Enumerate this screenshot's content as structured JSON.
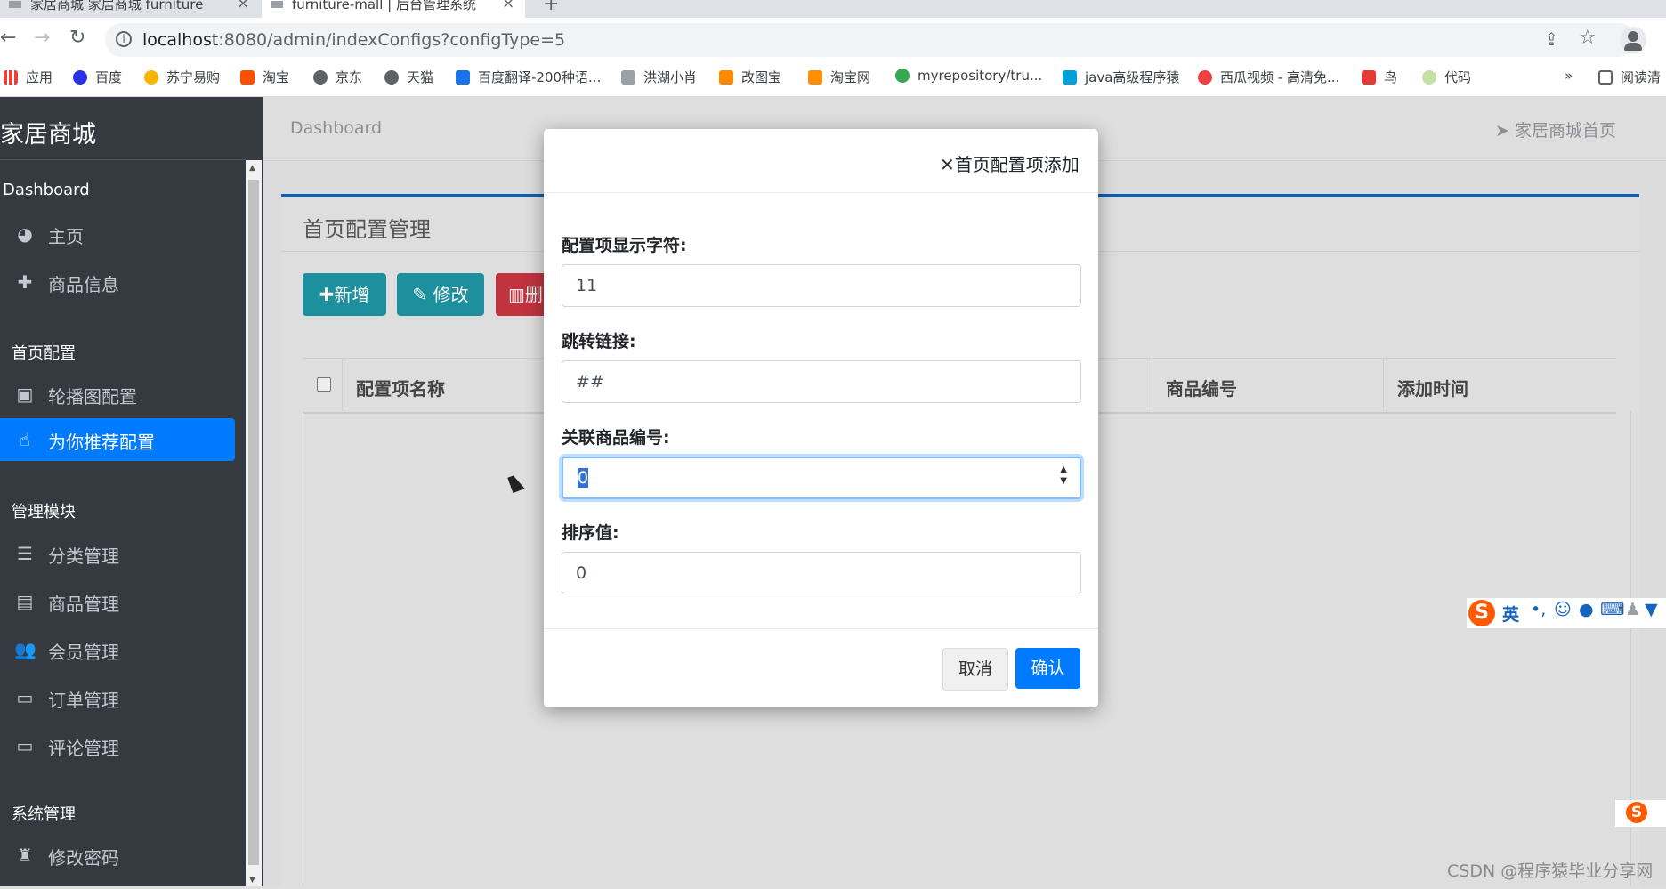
{
  "browser": {
    "tabs": [
      {
        "title": "家居商城 家居商城 furniture"
      },
      {
        "title": "furniture-mall | 后台管理系统"
      }
    ],
    "new_tab": "+",
    "url_host": "localhost",
    "url_rest": ":8080/admin/indexConfigs?configType=5",
    "bookmarks": [
      "应用",
      "百度",
      "苏宁易购",
      "淘宝",
      "京东",
      "天猫",
      "百度翻译-200种语...",
      "洪湖小肖",
      "改图宝",
      "淘宝网",
      "myrepository/tru...",
      "java高级程序猿",
      "西瓜视频 - 高清免...",
      "鸟",
      "代码"
    ],
    "bookmarks_more": "»",
    "reading_list": "阅读清"
  },
  "sidebar": {
    "brand": "家居商城",
    "sections": [
      {
        "title": "Dashboard",
        "items": [
          {
            "label": "主页",
            "icon": "dashboard-icon"
          },
          {
            "label": "商品信息",
            "icon": "plus-icon"
          }
        ]
      },
      {
        "title": "首页配置",
        "items": [
          {
            "label": "轮播图配置",
            "icon": "image-icon"
          },
          {
            "label": "为你推荐配置",
            "icon": "hand-pointer-icon"
          }
        ]
      },
      {
        "title": "管理模块",
        "items": [
          {
            "label": "分类管理",
            "icon": "list-icon"
          },
          {
            "label": "商品管理",
            "icon": "archive-icon"
          },
          {
            "label": "会员管理",
            "icon": "users-icon"
          },
          {
            "label": "订单管理",
            "icon": "money-icon"
          },
          {
            "label": "评论管理",
            "icon": "money-icon"
          }
        ]
      },
      {
        "title": "系统管理",
        "items": [
          {
            "label": "修改密码",
            "icon": "user-secret-icon"
          }
        ]
      }
    ]
  },
  "header": {
    "breadcrumb": "Dashboard",
    "home_link": "家居商城首页"
  },
  "card": {
    "title": "首页配置管理",
    "buttons": {
      "add": "新增",
      "edit": "修改",
      "delete": "删"
    },
    "columns": [
      "配置项名称",
      "商品编号",
      "添加时间"
    ]
  },
  "modal": {
    "title": "首页配置项添加",
    "fields": [
      {
        "label": "配置项显示字符:",
        "value": "11"
      },
      {
        "label": "跳转链接:",
        "value": "##"
      },
      {
        "label": "关联商品编号:",
        "value": "0"
      },
      {
        "label": "排序值:",
        "value": "0"
      }
    ],
    "cancel": "取消",
    "confirm": "确认"
  },
  "watermark": "CSDN @程序猿毕业分享网",
  "ime": {
    "lang": "英"
  },
  "colors": {
    "sidebar": "#343a40",
    "primary": "#007bff",
    "teal": "#17a2b8",
    "danger": "#dc3545",
    "card_accent": "#0c5fb8"
  }
}
